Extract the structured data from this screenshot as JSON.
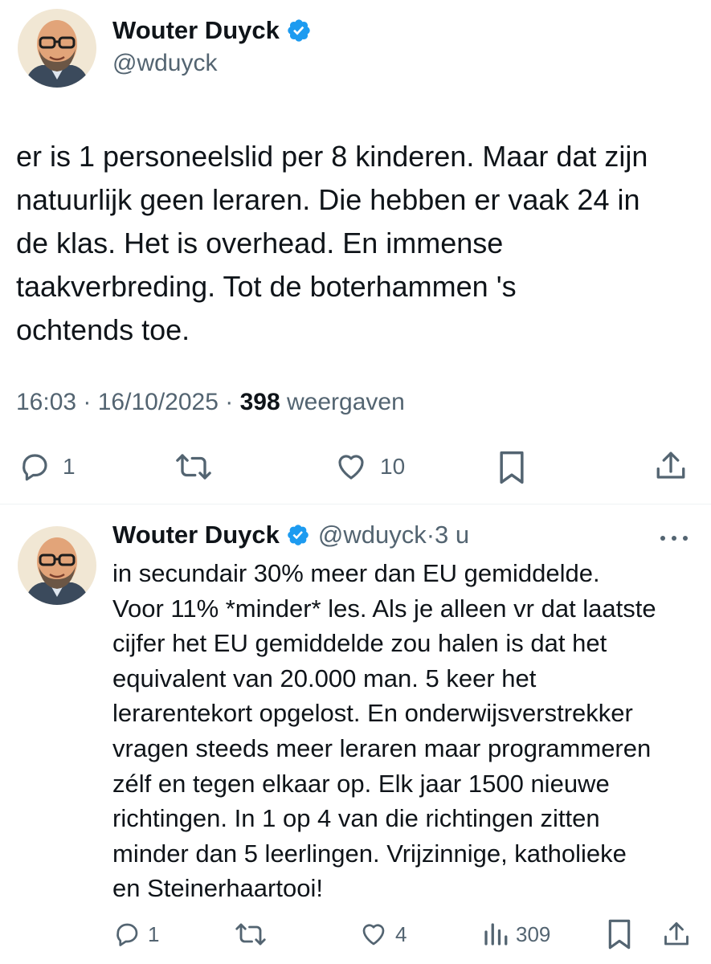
{
  "tweet1": {
    "author_name": "Wouter Duyck",
    "author_handle": "@wduyck",
    "verified": true,
    "text_lines": [
      "er is 1 personeelslid per 8 kinderen. Maar dat zijn",
      "natuurlijk geen leraren. Die hebben er vaak 24 in",
      "de klas. Het is overhead. En immense",
      "taakverbreding. Tot de boterhammen 's",
      "ochtends toe."
    ],
    "time": "16:03",
    "date": "16/10/2025",
    "views_count": "398",
    "views_label": "weergaven",
    "replies": "1",
    "likes": "10"
  },
  "tweet2": {
    "author_name": "Wouter Duyck",
    "author_handle": "@wduyck",
    "time_ago": "3 u",
    "verified": true,
    "text_lines": [
      "in secundair 30% meer dan EU gemiddelde.",
      "Voor 11% *minder* les. Als je alleen vr dat laatste",
      "cijfer het EU gemiddelde zou halen is dat het",
      "equivalent van 20.000 man. 5 keer het",
      "lerarentekort opgelost. En onderwijsverstrekker",
      "vragen steeds meer leraren maar programmeren",
      "zélf en tegen elkaar op. Elk jaar 1500 nieuwe",
      "richtingen. In 1 op 4 van die richtingen zitten",
      "minder dan 5 leerlingen. Vrijzinnige, katholieke",
      "en Steinerhaartooi!"
    ],
    "replies": "1",
    "likes": "4",
    "views": "309"
  },
  "colors": {
    "text": "#0f1419",
    "secondary": "#536471",
    "verified_blue": "#1d9bf0",
    "divider": "#eff3f4"
  },
  "icons": [
    "verified-badge-icon",
    "reply-icon",
    "retweet-icon",
    "like-icon",
    "bookmark-icon",
    "share-icon",
    "views-icon",
    "more-icon"
  ]
}
